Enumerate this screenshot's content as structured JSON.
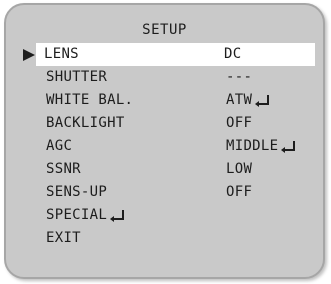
{
  "menu": {
    "title": "SETUP",
    "items": [
      {
        "label": "LENS",
        "value": "DC",
        "submenu": false,
        "selected": true
      },
      {
        "label": "SHUTTER",
        "value": "---",
        "submenu": false
      },
      {
        "label": "WHITE BAL.",
        "value": "ATW",
        "submenu": true
      },
      {
        "label": "BACKLIGHT",
        "value": "OFF",
        "submenu": false
      },
      {
        "label": "AGC",
        "value": "MIDDLE",
        "submenu": true
      },
      {
        "label": "SSNR",
        "value": "LOW",
        "submenu": false
      },
      {
        "label": "SENS-UP",
        "value": "OFF",
        "submenu": false
      },
      {
        "label": "SPECIAL",
        "value": "",
        "submenu": true
      },
      {
        "label": "EXIT",
        "value": "",
        "submenu": false
      }
    ]
  },
  "icons": {
    "cursor": "cursor-arrow-icon",
    "enter": "enter-return-icon"
  },
  "colors": {
    "panel_background": "#c9c9c9",
    "panel_border": "#a6a6a6",
    "selected_row": "#ffffff",
    "text": "#1d1d1d"
  }
}
